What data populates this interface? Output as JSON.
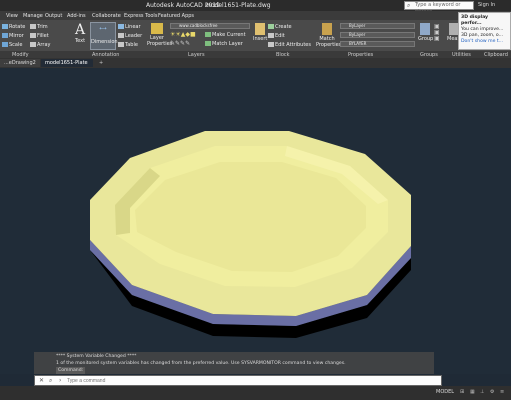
{
  "app": {
    "title": "Autodesk AutoCAD 2019",
    "file": "model1651-Plate.dwg"
  },
  "search": {
    "placeholder": "Type a keyword or phrase",
    "sign_in": "Sign In"
  },
  "menu": [
    "View",
    "Manage",
    "Output",
    "Add-ins",
    "Collaborate",
    "Express Tools",
    "Featured Apps"
  ],
  "modify": {
    "rotate": "Rotate",
    "trim": "Trim",
    "mirror": "Mirror",
    "fillet": "Fillet",
    "scale": "Scale",
    "array": "Array"
  },
  "annotation": {
    "text": "Text",
    "dimension": "Dimension",
    "linear": "Linear",
    "leader": "Leader",
    "table": "Table"
  },
  "layers": {
    "properties": "Layer Properties",
    "current": "www.cadblocksfree",
    "make_current": "Make Current",
    "match_layer": "Match Layer"
  },
  "block": {
    "insert": "Insert",
    "create": "Create",
    "edit": "Edit",
    "edit_attributes": "Edit Attributes"
  },
  "properties": {
    "match": "Match Properties",
    "color": "ByLayer",
    "linetype": "ByLayer",
    "lineweight": "BYLAYER"
  },
  "group": {
    "label": "Group"
  },
  "measure": {
    "label": "Measure"
  },
  "panels": [
    "Modify",
    "Annotation",
    "Layers",
    "Block",
    "Properties",
    "Groups",
    "Utilities",
    "Clipboard"
  ],
  "tooltip": {
    "title": "3D display perfor...",
    "line1": "You can improve...",
    "line2": "3D pan, zoom, o...",
    "link": "Don't show me t..."
  },
  "tabs": [
    "...eDrawing2",
    "model1651-Plate"
  ],
  "console": {
    "l1": "**** System Variable Changed ****",
    "l2": "1 of the monitored system variables has changed from the preferred value. Use SYSVARMONITOR command to view changes.",
    "l3": "Command:"
  },
  "command": {
    "placeholder": "Type a command"
  },
  "status": {
    "model": "MODEL"
  }
}
